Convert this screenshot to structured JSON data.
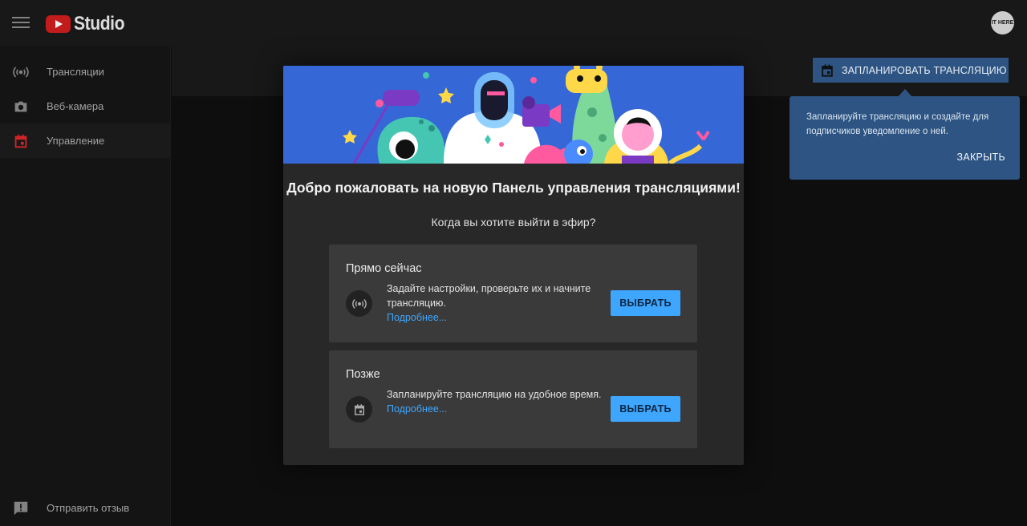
{
  "app": {
    "logo_text": "Studio",
    "avatar_text": "IT HERE"
  },
  "sidebar": {
    "items": [
      {
        "label": "Трансляции",
        "icon": "broadcast-icon"
      },
      {
        "label": "Веб-камера",
        "icon": "camera-icon"
      },
      {
        "label": "Управление",
        "icon": "calendar-icon",
        "active": true
      }
    ],
    "feedback_label": "Отправить отзыв"
  },
  "toolbar": {
    "schedule_label": "ЗАПЛАНИРОВАТЬ ТРАНСЛЯЦИЮ"
  },
  "tooltip": {
    "text": "Запланируйте трансляцию и создайте для подписчиков уведомление о ней.",
    "close_label": "ЗАКРЫТЬ"
  },
  "modal": {
    "title": "Добро пожаловать на новую Панель управления трансляциями!",
    "subtitle": "Когда вы хотите выйти в эфир?",
    "options": [
      {
        "title": "Прямо сейчас",
        "description": "Задайте настройки, проверьте их и начните трансляцию.",
        "link": "Подробнее...",
        "button": "ВЫБРАТЬ",
        "icon": "broadcast-icon"
      },
      {
        "title": "Позже",
        "description": "Запланируйте трансляцию на удобное время.",
        "link": "Подробнее...",
        "button": "ВЫБРАТЬ",
        "icon": "calendar-icon"
      }
    ]
  },
  "colors": {
    "accent": "#3ea6ff",
    "banner": "#3567d6",
    "tooltip": "#2d5482",
    "active_icon": "#e0262b"
  }
}
